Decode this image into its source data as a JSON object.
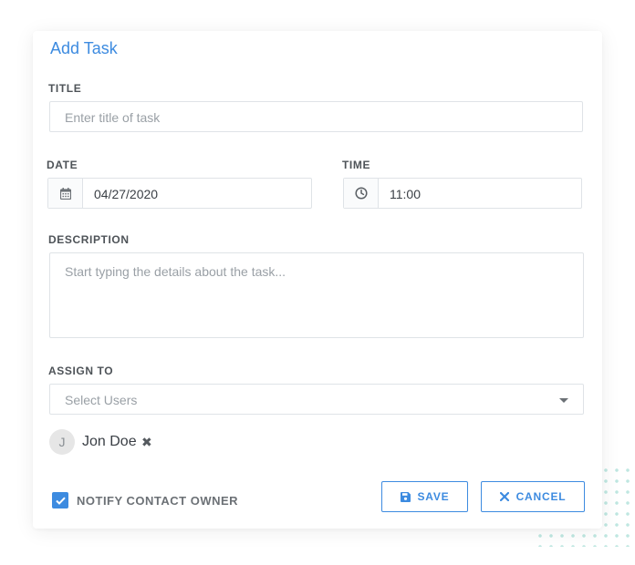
{
  "form": {
    "title": "Add Task",
    "title_field": {
      "label": "TITLE",
      "placeholder": "Enter title of task"
    },
    "date_field": {
      "label": "DATE",
      "value": "04/27/2020",
      "icon": "calendar-icon"
    },
    "time_field": {
      "label": "TIME",
      "value": "11:00",
      "icon": "clock-icon"
    },
    "description_field": {
      "label": "DESCRIPTION",
      "placeholder": "Start typing the details about the task..."
    },
    "assign_field": {
      "label": "ASSIGN TO",
      "placeholder": "Select Users"
    },
    "assignees": [
      {
        "initial": "J",
        "name": "Jon Doe",
        "remove_glyph": "✖"
      }
    ],
    "notify": {
      "label": "NOTIFY CONTACT OWNER",
      "checked": true
    },
    "buttons": {
      "save": "SAVE",
      "cancel": "CANCEL"
    }
  },
  "colors": {
    "accent": "#3d8be0",
    "border": "#dfe3e7",
    "label": "#4e5358",
    "placeholder": "#9aa0a6"
  }
}
